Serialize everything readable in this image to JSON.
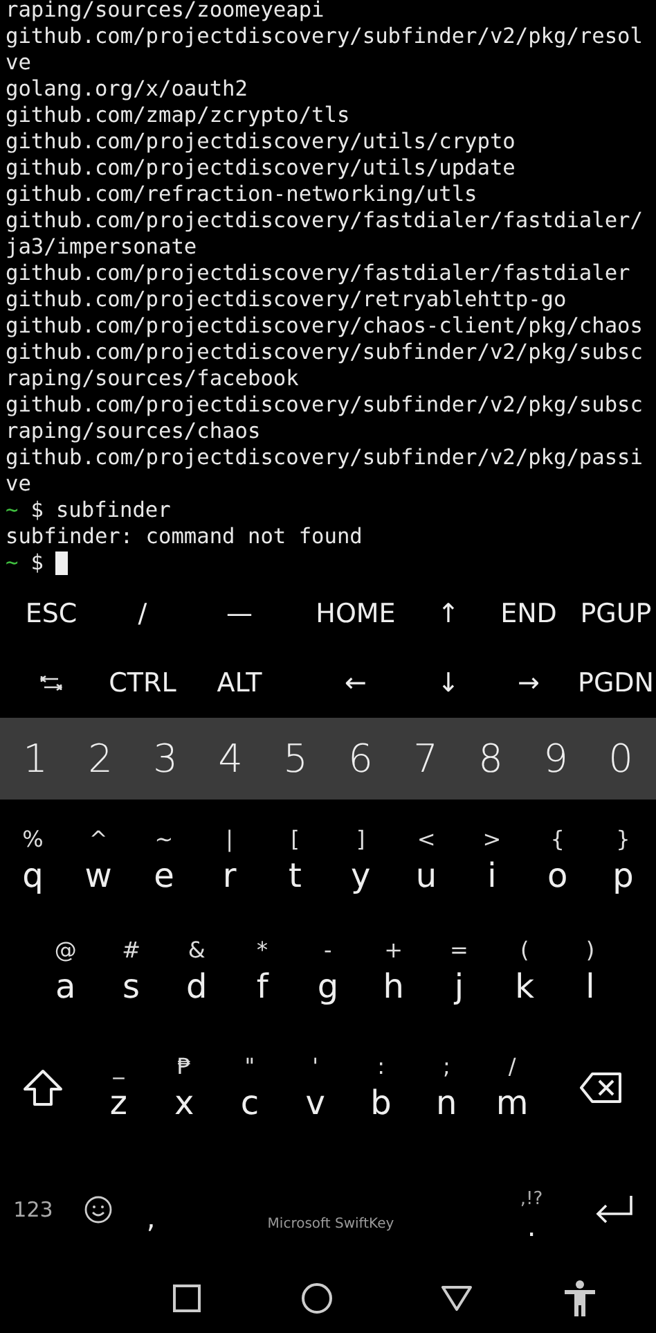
{
  "terminal": {
    "lines": [
      {
        "kind": "output",
        "text": "raping/sources/zoomeyeapi"
      },
      {
        "kind": "output",
        "text": "github.com/projectdiscovery/subfinder/v2/pkg/resol"
      },
      {
        "kind": "output",
        "text": "ve"
      },
      {
        "kind": "output",
        "text": "golang.org/x/oauth2"
      },
      {
        "kind": "output",
        "text": "github.com/zmap/zcrypto/tls"
      },
      {
        "kind": "output",
        "text": "github.com/projectdiscovery/utils/crypto"
      },
      {
        "kind": "output",
        "text": "github.com/projectdiscovery/utils/update"
      },
      {
        "kind": "output",
        "text": "github.com/refraction-networking/utls"
      },
      {
        "kind": "output",
        "text": "github.com/projectdiscovery/fastdialer/fastdialer/"
      },
      {
        "kind": "output",
        "text": "ja3/impersonate"
      },
      {
        "kind": "output",
        "text": "github.com/projectdiscovery/fastdialer/fastdialer"
      },
      {
        "kind": "output",
        "text": "github.com/projectdiscovery/retryablehttp-go"
      },
      {
        "kind": "output",
        "text": "github.com/projectdiscovery/chaos-client/pkg/chaos"
      },
      {
        "kind": "output",
        "text": "github.com/projectdiscovery/subfinder/v2/pkg/subsc"
      },
      {
        "kind": "output",
        "text": "raping/sources/facebook"
      },
      {
        "kind": "output",
        "text": "github.com/projectdiscovery/subfinder/v2/pkg/subsc"
      },
      {
        "kind": "output",
        "text": "raping/sources/chaos"
      },
      {
        "kind": "output",
        "text": "github.com/projectdiscovery/subfinder/v2/pkg/passi"
      },
      {
        "kind": "output",
        "text": "ve"
      },
      {
        "kind": "prompt",
        "dir": "~",
        "symbol": "$",
        "text": "subfinder"
      },
      {
        "kind": "output",
        "text": "subfinder: command not found"
      },
      {
        "kind": "prompt",
        "dir": "~",
        "symbol": "$",
        "cursor": true
      }
    ]
  },
  "extra_keys": [
    [
      {
        "kind": "text",
        "label": "ESC"
      },
      {
        "kind": "text",
        "label": "/"
      },
      {
        "kind": "text",
        "label": "—"
      },
      {
        "kind": "text",
        "label": "HOME"
      },
      {
        "kind": "text",
        "label": "↑"
      },
      {
        "kind": "text",
        "label": "END"
      },
      {
        "kind": "text",
        "label": "PGUP"
      }
    ],
    [
      {
        "kind": "tab"
      },
      {
        "kind": "text",
        "label": "CTRL"
      },
      {
        "kind": "text",
        "label": "ALT"
      },
      {
        "kind": "text",
        "label": "←"
      },
      {
        "kind": "text",
        "label": "↓"
      },
      {
        "kind": "text",
        "label": "→"
      },
      {
        "kind": "text",
        "label": "PGDN"
      }
    ]
  ],
  "number_row": [
    "1",
    "2",
    "3",
    "4",
    "5",
    "6",
    "7",
    "8",
    "9",
    "0"
  ],
  "letter_rows": [
    [
      {
        "kind": "letter",
        "hint": "%",
        "label": "q"
      },
      {
        "kind": "letter",
        "hint": "^",
        "label": "w"
      },
      {
        "kind": "letter",
        "hint": "~",
        "label": "e"
      },
      {
        "kind": "letter",
        "hint": "|",
        "label": "r"
      },
      {
        "kind": "letter",
        "hint": "[",
        "label": "t"
      },
      {
        "kind": "letter",
        "hint": "]",
        "label": "y"
      },
      {
        "kind": "letter",
        "hint": "<",
        "label": "u"
      },
      {
        "kind": "letter",
        "hint": ">",
        "label": "i"
      },
      {
        "kind": "letter",
        "hint": "{",
        "label": "o"
      },
      {
        "kind": "letter",
        "hint": "}",
        "label": "p"
      }
    ],
    [
      {
        "kind": "letter",
        "hint": "@",
        "label": "a"
      },
      {
        "kind": "letter",
        "hint": "#",
        "label": "s"
      },
      {
        "kind": "letter",
        "hint": "&",
        "label": "d"
      },
      {
        "kind": "letter",
        "hint": "*",
        "label": "f"
      },
      {
        "kind": "letter",
        "hint": "-",
        "label": "g"
      },
      {
        "kind": "letter",
        "hint": "+",
        "label": "h"
      },
      {
        "kind": "letter",
        "hint": "=",
        "label": "j"
      },
      {
        "kind": "letter",
        "hint": "(",
        "label": "k"
      },
      {
        "kind": "letter",
        "hint": ")",
        "label": "l"
      }
    ],
    [
      {
        "kind": "shift"
      },
      {
        "kind": "letter",
        "hint": "_",
        "label": "z"
      },
      {
        "kind": "letter",
        "hint": "₱",
        "label": "x"
      },
      {
        "kind": "letter",
        "hint": "\"",
        "label": "c"
      },
      {
        "kind": "letter",
        "hint": "'",
        "label": "v"
      },
      {
        "kind": "letter",
        "hint": ":",
        "label": "b"
      },
      {
        "kind": "letter",
        "hint": ";",
        "label": "n"
      },
      {
        "kind": "letter",
        "hint": "/",
        "label": "m"
      },
      {
        "kind": "backspace"
      }
    ]
  ],
  "bottom_row": [
    {
      "kind": "symbols",
      "label": "123"
    },
    {
      "kind": "emoji"
    },
    {
      "kind": "letter",
      "label": ","
    },
    {
      "kind": "space",
      "label": "Microsoft SwiftKey"
    },
    {
      "kind": "letter",
      "hint": ",!?",
      "label": "."
    },
    {
      "kind": "enter"
    }
  ],
  "nav_bar": [
    {
      "kind": "recents"
    },
    {
      "kind": "home"
    },
    {
      "kind": "back"
    },
    {
      "kind": "accessibility"
    }
  ]
}
